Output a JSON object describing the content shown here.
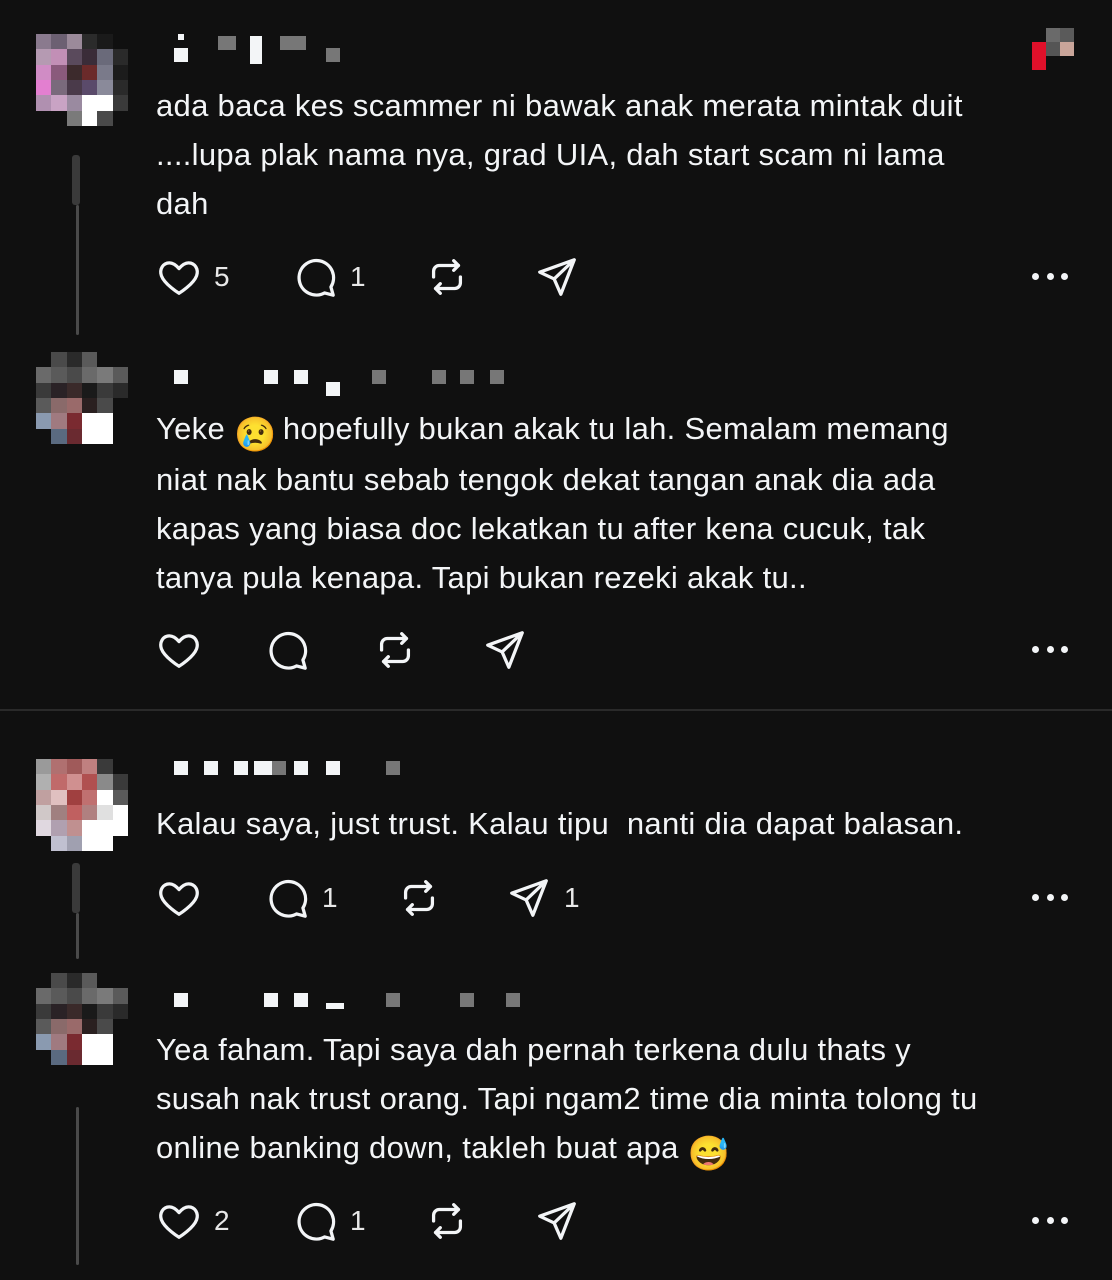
{
  "posts": [
    {
      "text": "ada baca kes scammer ni bawak anak merata mintak duit\n....lupa plak nama nya, grad UIA, dah start scam ni lama\ndah",
      "likes": "5",
      "replies": "1",
      "shares": ""
    },
    {
      "text_before": "Yeke ",
      "emoji": "😢",
      "text_after": " hopefully bukan akak tu lah. Semalam memang\nniat nak bantu sebab tengok dekat tangan anak dia ada\nkapas yang biasa doc lekatkan tu after kena cucuk, tak\ntanya pula kenapa. Tapi bukan rezeki akak tu..",
      "likes": "",
      "replies": "",
      "shares": ""
    },
    {
      "text": "Kalau saya, just trust. Kalau tipu  nanti dia dapat balasan.",
      "likes": "",
      "replies": "1",
      "shares": "1"
    },
    {
      "text_before": "Yea faham. Tapi saya dah pernah terkena dulu thats y\nsusah nak trust orang. Tapi ngam2 time dia minta tolong tu\nonline banking down, takleh buat apa ",
      "emoji": "😅",
      "text_after": "",
      "likes": "2",
      "replies": "1",
      "shares": ""
    }
  ],
  "icons": {
    "like": "heart-icon",
    "reply": "comment-icon",
    "repost": "repost-icon",
    "share": "send-icon",
    "more": "more-dots-icon"
  },
  "colors": {
    "background": "#101010",
    "text": "#f3f5f7",
    "thread_line": "#3a3a3a"
  }
}
